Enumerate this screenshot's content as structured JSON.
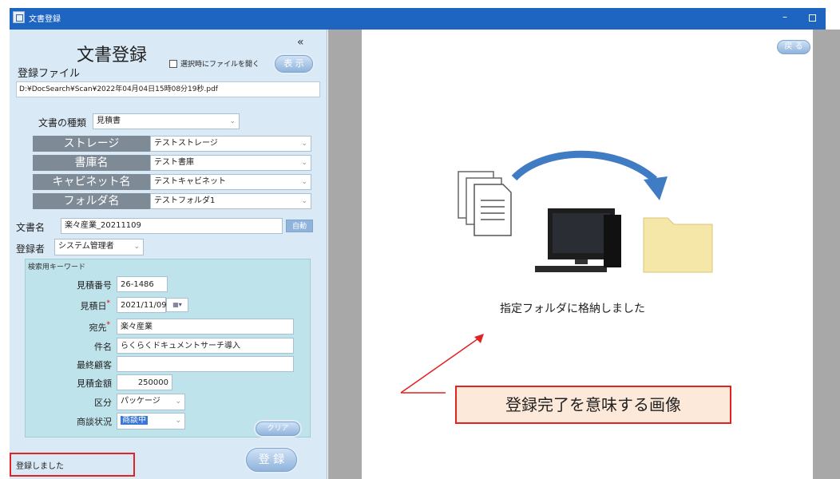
{
  "window": {
    "title": "文書登録",
    "minimize_label": "–"
  },
  "panel": {
    "collapse_label": "«",
    "title": "文書登録",
    "open_on_select_label": "選択時にファイルを開く",
    "show_button": "表 示",
    "file_label": "登録ファイル",
    "file_path": "D:¥DocSearch¥Scan¥2022年04月04日15時08分19秒.pdf",
    "doc_type_label": "文書の種類",
    "doc_type_value": "見積書",
    "storage_label": "ストレージ",
    "storage_value": "テストストレージ",
    "library_label": "書庫名",
    "library_value": "テスト書庫",
    "cabinet_label": "キャビネット名",
    "cabinet_value": "テストキャビネット",
    "folder_label": "フォルダ名",
    "folder_value": "テストフォルダ1",
    "doc_name_label": "文書名",
    "doc_name_value": "楽々産業_20211109",
    "auto_button": "自動",
    "registrant_label": "登録者",
    "registrant_value": "システム管理者"
  },
  "keywords": {
    "title": "検索用キーワード",
    "estimate_no_label": "見積番号",
    "estimate_no_value": "26-1486",
    "estimate_date_label": "見積日",
    "estimate_date_value": "2021/11/09",
    "recipient_label": "宛先",
    "recipient_value": "楽々産業",
    "subject_label": "件名",
    "subject_value": "らくらくドキュメントサーチ導入",
    "final_customer_label": "最終顧客",
    "final_customer_value": "",
    "amount_label": "見積金額",
    "amount_value": "250000",
    "category_label": "区分",
    "category_value": "パッケージ",
    "negotiation_label": "商談状況",
    "negotiation_value": "商談中",
    "required_mark": "*",
    "clear_button": "クリア"
  },
  "footer": {
    "status": "登録しました",
    "register_button": "登 録"
  },
  "preview": {
    "back_button": "戻 る",
    "message": "指定フォルダに格納しました",
    "annotation": "登録完了を意味する画像"
  },
  "colors": {
    "titlebar": "#1d65c1",
    "panel": "#d9e9f6",
    "keyword_bg": "#bfe3ea",
    "highlight": "#e02424"
  }
}
